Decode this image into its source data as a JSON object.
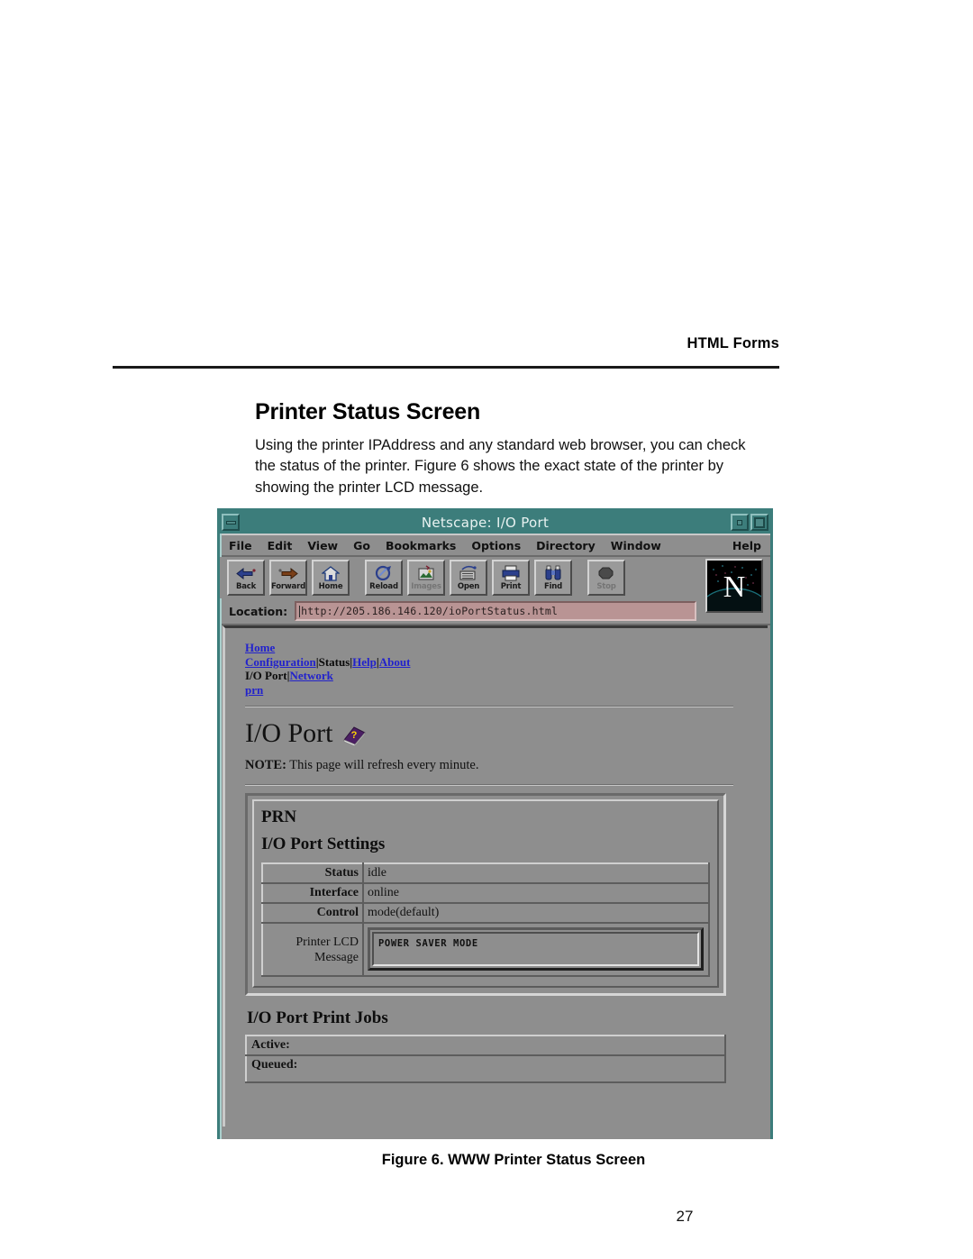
{
  "document": {
    "running_header": "HTML Forms",
    "section_title": "Printer Status Screen",
    "body_paragraph": "Using the printer IPAddress and any standard web browser, you can check the status of the printer. Figure 6 shows the exact state of the printer by showing the printer LCD message.",
    "figure_caption": "Figure 6. WWW Printer Status Screen",
    "page_number": "27"
  },
  "browser": {
    "window_title": "Netscape: I/O Port",
    "title_bar_color": "#3c7d7b",
    "chrome_color": "#8e8e8e",
    "menus": [
      "File",
      "Edit",
      "View",
      "Go",
      "Bookmarks",
      "Options",
      "Directory",
      "Window"
    ],
    "help_menu": "Help",
    "toolbar": [
      {
        "label": "Back",
        "icon": "back-arrow-icon"
      },
      {
        "label": "Forward",
        "icon": "forward-arrow-icon"
      },
      {
        "label": "Home",
        "icon": "house-icon"
      },
      {
        "label": "Reload",
        "icon": "reload-icon"
      },
      {
        "label": "Images",
        "icon": "images-icon"
      },
      {
        "label": "Open",
        "icon": "open-icon"
      },
      {
        "label": "Print",
        "icon": "printer-icon"
      },
      {
        "label": "Find",
        "icon": "binoculars-icon"
      },
      {
        "label": "Stop",
        "icon": "stop-sign-icon"
      }
    ],
    "location": {
      "label": "Location:",
      "value": "http://205.186.146.120/ioPortStatus.html",
      "field_color": "#b99494"
    },
    "logo_letter": "N"
  },
  "webpage": {
    "nav_row1": {
      "home": "Home"
    },
    "nav_row2": {
      "configuration": "Configuration",
      "sep1": "|",
      "status": "Status",
      "sep2": "|",
      "help": "Help",
      "sep3": "|",
      "about": "About"
    },
    "nav_row3": {
      "io_port": "I/O Port",
      "sep1": "|",
      "network": "Network"
    },
    "nav_row4": {
      "prn": "prn"
    },
    "page_title": "I/O Port",
    "note_label": "NOTE:",
    "note_text": "This page will refresh every minute.",
    "panel": {
      "port_name": "PRN",
      "settings_heading": "I/O Port Settings",
      "rows": [
        {
          "label": "Status",
          "value": "idle"
        },
        {
          "label": "Interface",
          "value": "online"
        },
        {
          "label": "Control",
          "value": "mode(default)"
        }
      ],
      "lcd_label_line1": "Printer LCD",
      "lcd_label_line2": "Message",
      "lcd_message": "POWER SAVER MODE"
    },
    "jobs": {
      "heading": "I/O Port Print Jobs",
      "active_label": "Active:",
      "queued_label": "Queued:"
    },
    "link_color": "#2222cc"
  }
}
